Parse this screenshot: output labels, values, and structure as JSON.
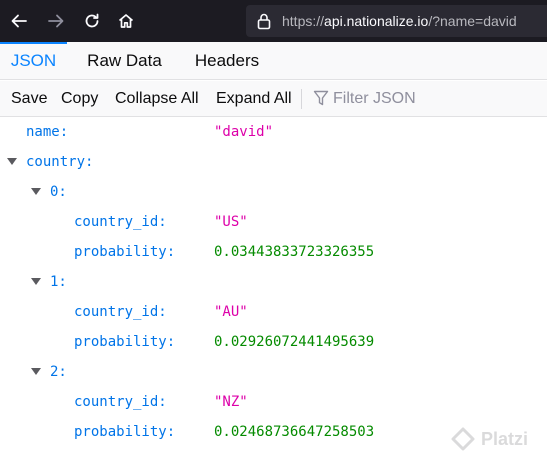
{
  "browser": {
    "url_host": "api.nationalize.io",
    "url_prefix": "https://",
    "url_path": "/?name=david"
  },
  "tabs": [
    {
      "label": "JSON",
      "active": true
    },
    {
      "label": "Raw Data",
      "active": false
    },
    {
      "label": "Headers",
      "active": false
    }
  ],
  "toolbar": {
    "save_label": "Save",
    "copy_label": "Copy",
    "collapse_label": "Collapse All",
    "expand_label": "Expand All",
    "filter_placeholder": "Filter JSON"
  },
  "json": {
    "name_key": "name:",
    "name_value": "\"david\"",
    "country_key": "country:",
    "entries": [
      {
        "index_key": "0:",
        "country_id_key": "country_id:",
        "country_id_value": "\"US\"",
        "probability_key": "probability:",
        "probability_value": "0.03443833723326355"
      },
      {
        "index_key": "1:",
        "country_id_key": "country_id:",
        "country_id_value": "\"AU\"",
        "probability_key": "probability:",
        "probability_value": "0.02926072441495639"
      },
      {
        "index_key": "2:",
        "country_id_key": "country_id:",
        "country_id_value": "\"NZ\"",
        "probability_key": "probability:",
        "probability_value": "0.02468736647258503"
      }
    ]
  },
  "watermark": "Platzi",
  "colors": {
    "accent": "#0a84ff",
    "key": "#0074e8",
    "string": "#dd00a9",
    "number": "#058b00"
  }
}
